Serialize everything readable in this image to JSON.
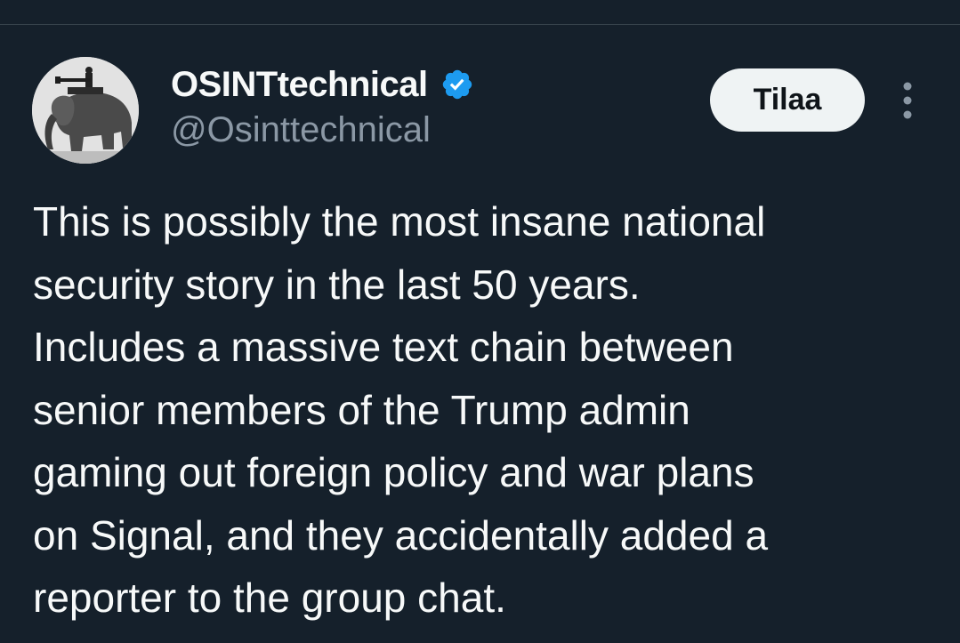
{
  "tweet": {
    "author": {
      "display_name": "OSINTtechnical",
      "handle": "@Osinttechnical",
      "verified": true,
      "avatar_icon": "elephant-machine-gun-avatar",
      "verified_icon": "verified-badge-icon"
    },
    "actions": {
      "subscribe_label": "Tilaa",
      "more_icon": "more-vertical-icon"
    },
    "text_lines": [
      "This is possibly the most insane national",
      "security story in the last 50 years.",
      "Includes a massive text chain between",
      "senior members of the Trump admin",
      "gaming out foreign policy and war plans",
      "on Signal, and they accidentally added a",
      "reporter to the group chat."
    ]
  },
  "colors": {
    "background": "#15202b",
    "text_primary": "#f7f9f9",
    "text_secondary": "#8b98a5",
    "verified_blue": "#1d9bf0",
    "button_bg": "#eff3f4",
    "button_text": "#0f1419",
    "divider": "#38444d"
  }
}
